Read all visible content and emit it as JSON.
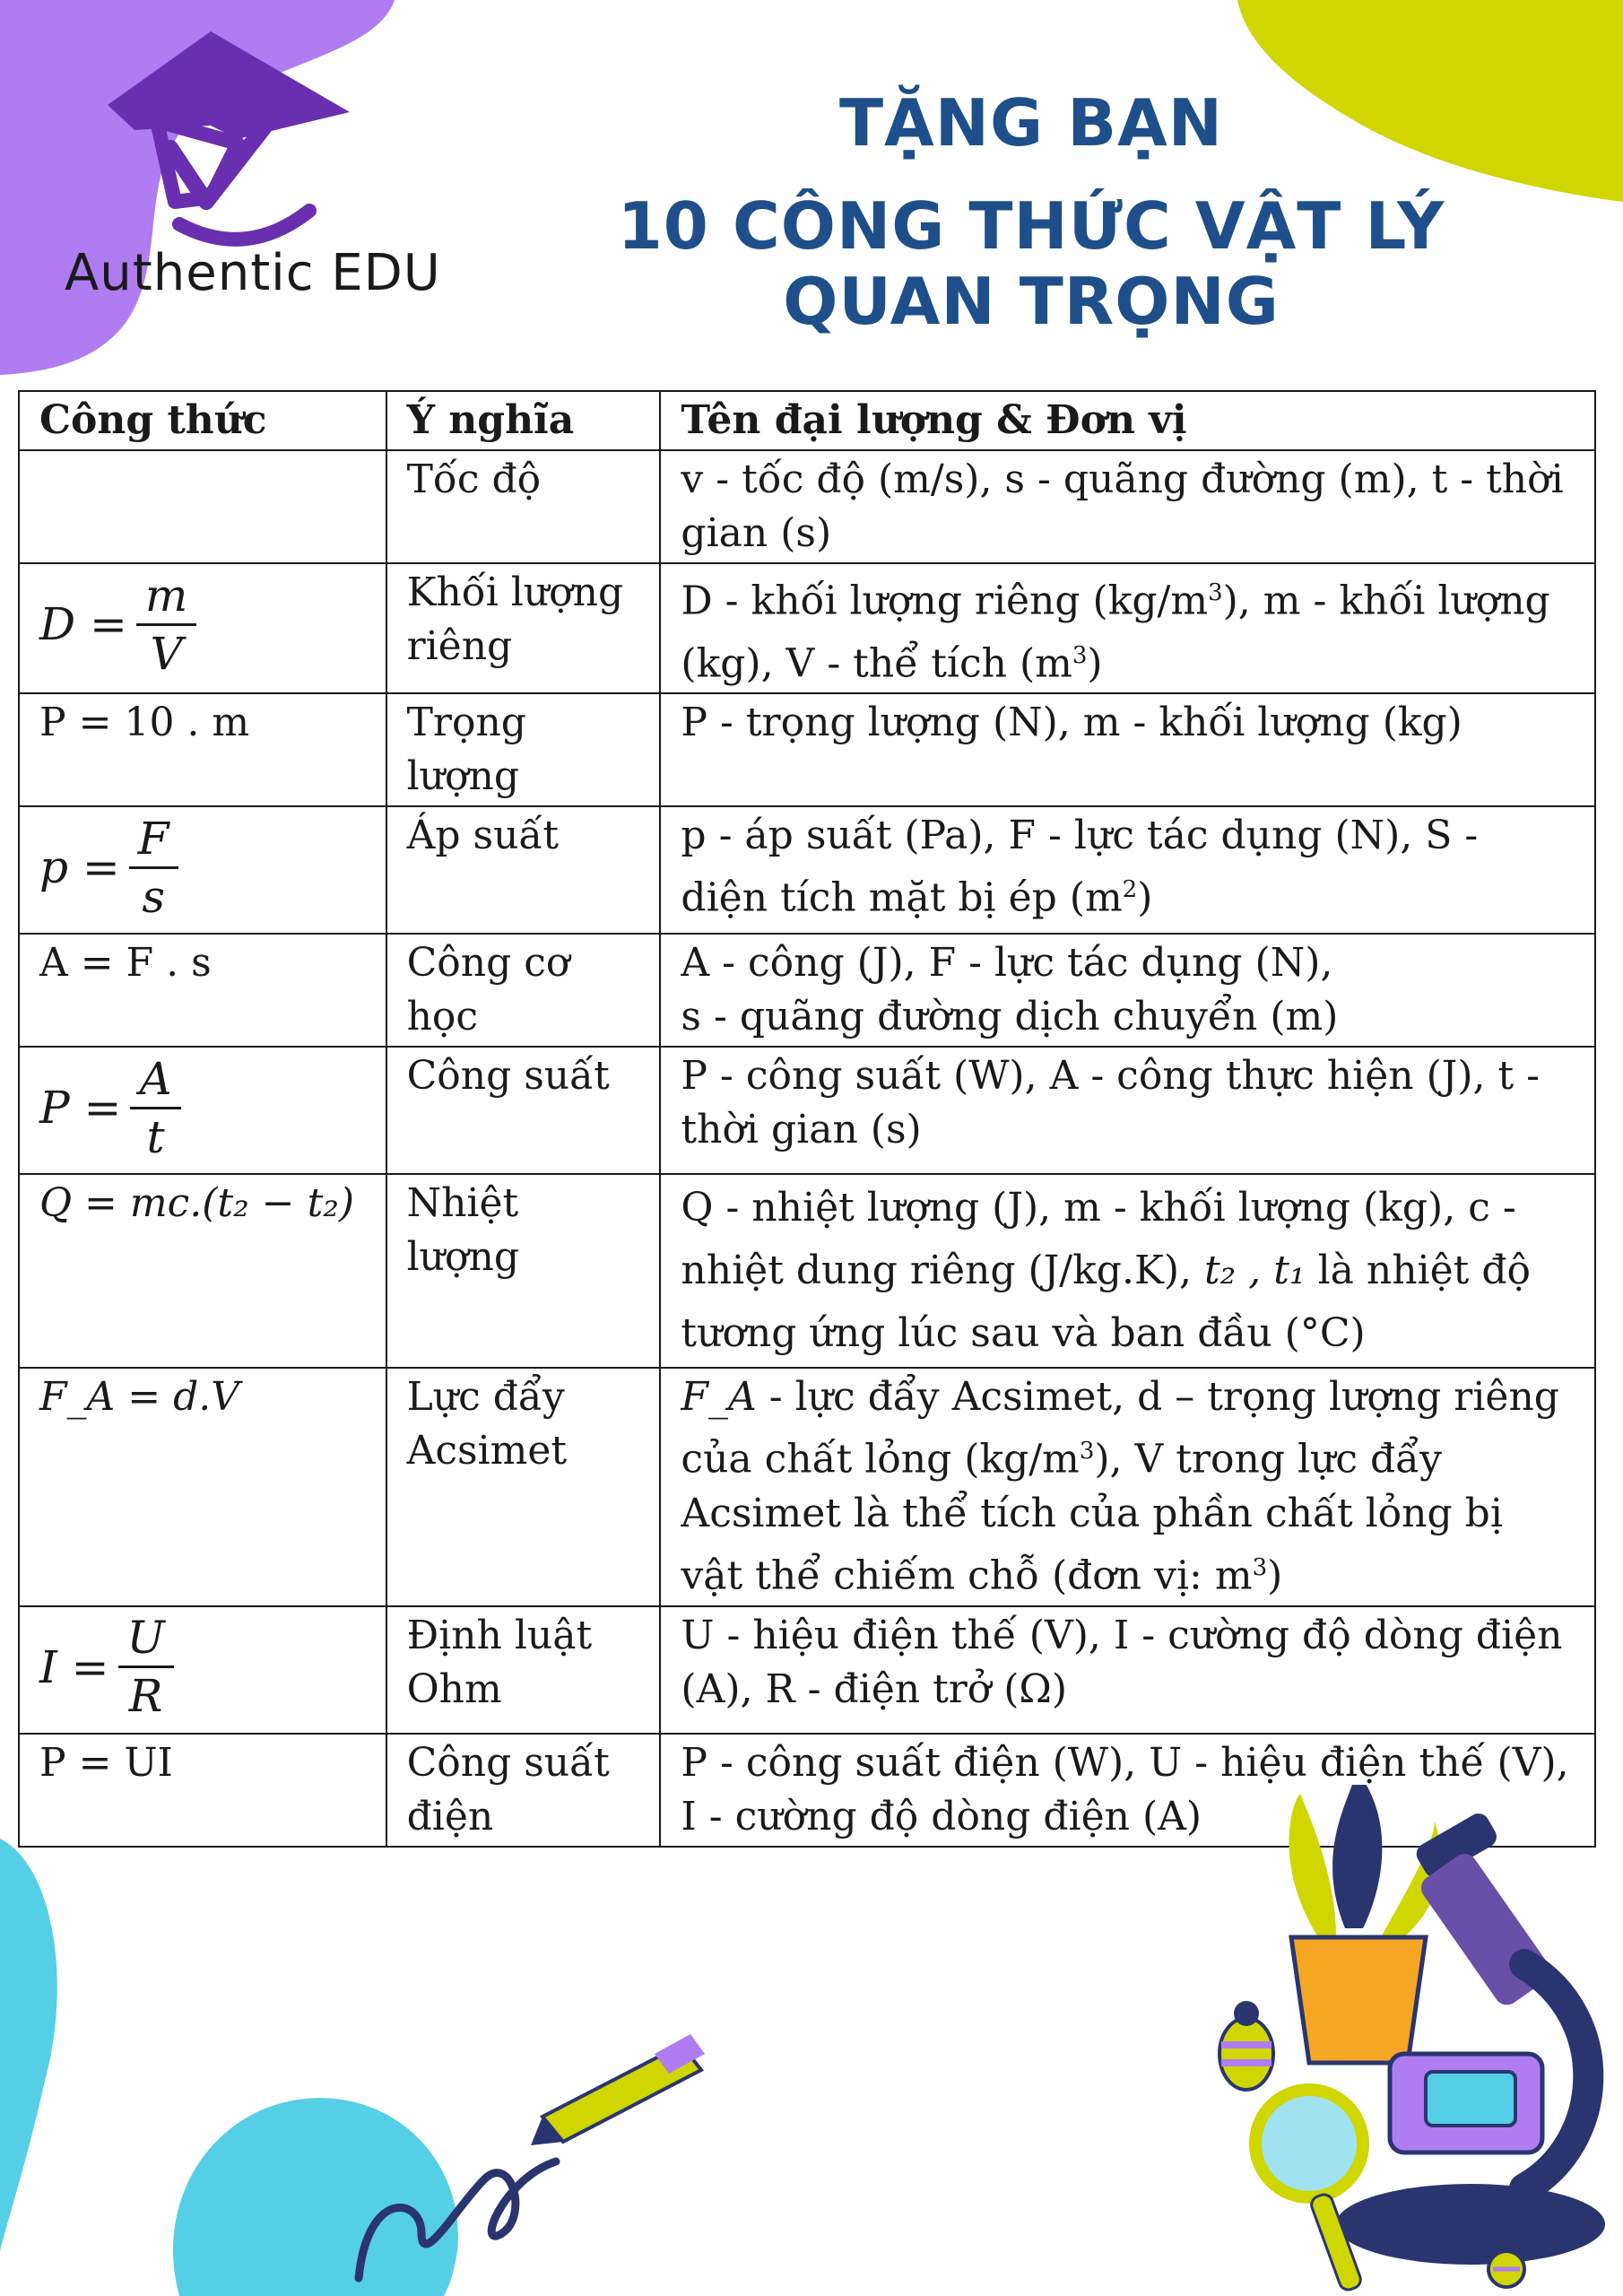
{
  "brand": {
    "name": "Authentic EDU"
  },
  "title": {
    "line1": "TẶNG BẠN",
    "line2": "10 CÔNG THỨC VẬT LÝ QUAN TRỌNG"
  },
  "table": {
    "headers": [
      "Công thức",
      "Ý nghĩa",
      "Tên đại lượng & Đơn vị"
    ],
    "rows": [
      {
        "meaning": "Tốc độ",
        "units": "v - tốc độ (m/s), s - quãng đường (m), t - thời gian (s)"
      },
      {
        "formula_lhs": "D =",
        "formula_num": "m",
        "formula_den": "V",
        "meaning": "Khối lượng riêng",
        "units_a": "D - khối lượng riêng (kg/m",
        "units_b": "), m - khối lượng (kg), V - thể tích (m",
        "units_c": ")"
      },
      {
        "formula": "P = 10 . m",
        "meaning": "Trọng lượng",
        "units": "P - trọng lượng (N), m - khối lượng (kg)"
      },
      {
        "formula_lhs": "p =",
        "formula_num": "F",
        "formula_den": "s",
        "meaning": "Áp suất",
        "units_a": "p - áp suất (Pa), F - lực tác dụng (N), S - diện tích mặt bị ép (m",
        "units_b": ")"
      },
      {
        "formula": "A = F . s",
        "meaning": "Công cơ học",
        "units_a": "A - công (J), F - lực tác dụng (N),",
        "units_b": "s - quãng đường dịch chuyển (m)"
      },
      {
        "formula_lhs": "P =",
        "formula_num": "A",
        "formula_den": "t",
        "meaning": "Công suất",
        "units": "P - công suất (W), A - công thực hiện (J), t - thời gian (s)"
      },
      {
        "formula": "Q = mc.(t₂ − t₂)",
        "meaning": "Nhiệt lượng",
        "units_a": "Q - nhiệt lượng (J), m - khối lượng (kg), c - nhiệt dung riêng (J/kg.K),",
        "units_sym": "t₂ , t₁",
        "units_b": "là nhiệt độ tương ứng lúc sau và ban đầu (°C)"
      },
      {
        "formula": "F_A = d.V",
        "meaning": "Lực đẩy Acsimet",
        "units_sym": "F_A",
        "units_a": "- lực đẩy Acsimet, d – trọng lượng riêng của chất lỏng (kg/m",
        "units_b": "),  V trong lực đẩy Acsimet là thể tích của phần chất lỏng bị vật thể chiếm chỗ (đơn vị: m",
        "units_c": ")"
      },
      {
        "formula_lhs": "I =",
        "formula_num": "U",
        "formula_den": "R",
        "meaning": "Định luật Ohm",
        "units": "U - hiệu điện thế (V), I - cường độ dòng điện (A), R - điện trở (Ω)"
      },
      {
        "formula": "P = UI",
        "meaning": "Công suất điện",
        "units": "P - công suất điện (W), U - hiệu điện thế (V), I - cường độ dòng điện (A)"
      }
    ],
    "sup": "3",
    "sup2": "2"
  },
  "colors": {
    "title": "#1f4f8a",
    "purple": "#b07cf2",
    "lime": "#cfd600",
    "cyan": "#55cfe6",
    "logo": "#6a2fb0"
  }
}
